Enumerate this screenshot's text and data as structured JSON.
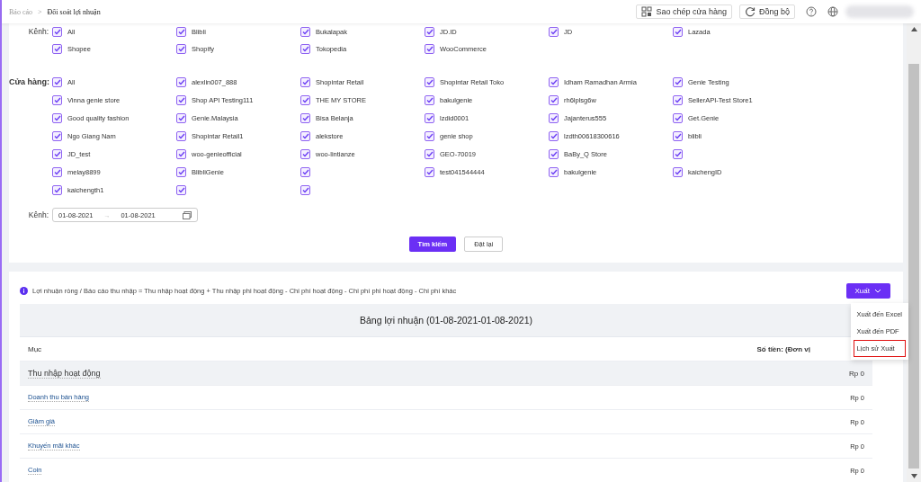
{
  "breadcrumb": {
    "parent": "Báo cáo",
    "separator": ">",
    "current": "Đối soát lợi nhuận"
  },
  "header_actions": {
    "copy_store": "Sao chép cửa hàng",
    "sync": "Đồng bộ"
  },
  "channels": {
    "label": "Kênh:",
    "options": [
      {
        "label": "All",
        "checked": true
      },
      {
        "label": "Blibli",
        "checked": true
      },
      {
        "label": "Bukalapak",
        "checked": true
      },
      {
        "label": "JD.ID",
        "checked": true
      },
      {
        "label": "JD",
        "checked": true
      },
      {
        "label": "Lazada",
        "checked": true
      },
      {
        "label": "Shopee",
        "checked": true
      },
      {
        "label": "Shopify",
        "checked": true
      },
      {
        "label": "Tokopedia",
        "checked": true
      },
      {
        "label": "WooCommerce",
        "checked": true
      }
    ]
  },
  "stores": {
    "label": "Cửa hàng:",
    "options": [
      {
        "label": "All",
        "checked": true
      },
      {
        "label": "alexlin007_888",
        "checked": true
      },
      {
        "label": "Shopintar Retail",
        "checked": true
      },
      {
        "label": "Shopintar Retail Toko",
        "checked": true
      },
      {
        "label": "Idham Ramadhan Armia",
        "checked": true
      },
      {
        "label": "Genie Testing",
        "checked": true
      },
      {
        "label": "Vinna genie store",
        "checked": true
      },
      {
        "label": "Shop API Testing111",
        "checked": true
      },
      {
        "label": "THE MY STORE",
        "checked": true
      },
      {
        "label": "bakulgenie",
        "checked": true
      },
      {
        "label": "rh6lplsg6w",
        "checked": true
      },
      {
        "label": "SellerAPI-Test Store1",
        "checked": true
      },
      {
        "label": "Good quality fashion",
        "checked": true
      },
      {
        "label": "Genie.Malaysia",
        "checked": true
      },
      {
        "label": "Bisa Belanja",
        "checked": true
      },
      {
        "label": "lzdid0001",
        "checked": true
      },
      {
        "label": "Jajanterus555",
        "checked": true
      },
      {
        "label": "Get.Genie",
        "checked": true
      },
      {
        "label": "Ngo Giang Nam",
        "checked": true
      },
      {
        "label": "Shopintar Retail1",
        "checked": true
      },
      {
        "label": "alekstore",
        "checked": true
      },
      {
        "label": "genie shop",
        "checked": true
      },
      {
        "label": "lzdth00618300616",
        "checked": true
      },
      {
        "label": "blibli",
        "checked": true
      },
      {
        "label": "JD_test",
        "checked": true
      },
      {
        "label": "woo-genieofficial",
        "checked": true
      },
      {
        "label": "woo-lintianze",
        "checked": true
      },
      {
        "label": "GEO-70019",
        "checked": true
      },
      {
        "label": "BaBy_Q Store",
        "checked": true
      },
      {
        "checked": true
      },
      {
        "label": "melay8899",
        "checked": true
      },
      {
        "label": "BlibliGenie",
        "checked": true
      },
      {
        "checked": true
      },
      {
        "label": "test041544444",
        "checked": true
      },
      {
        "label": "bakulgenie",
        "checked": true
      },
      {
        "label": "kaichengID",
        "checked": true
      },
      {
        "label": "kaichength1",
        "checked": true
      },
      {
        "checked": true
      },
      {
        "checked": true
      }
    ]
  },
  "date_range": {
    "label": "Kênh:",
    "start": "01-08-2021",
    "separator": "→",
    "end": "01-08-2021"
  },
  "buttons": {
    "search": "Tìm kiếm",
    "reset": "Đặt lại"
  },
  "formula": "Lợi nhuận ròng / Báo cáo thu nhập = Thu nhập hoạt động + Thu nhập phi hoạt động - Chi phí hoạt động - Chi phí phi hoạt động - Chi phí khác",
  "export": {
    "label": "Xuất",
    "expanded": true,
    "items": [
      {
        "label": "Xuất đến Excel",
        "highlighted": false
      },
      {
        "label": "Xuất đến PDF",
        "highlighted": false
      },
      {
        "label": "Lịch sử Xuất",
        "highlighted": true
      }
    ]
  },
  "table": {
    "title": "Bảng lợi nhuận (01-08-2021-01-08-2021)",
    "column_1": "Mục",
    "column_2": "Số tiền: (Đơn vị",
    "rows": [
      {
        "kind": "group",
        "label": "Thu nhập hoạt động",
        "amount": "Rp 0"
      },
      {
        "kind": "item",
        "label": "Doanh thu bán hàng",
        "amount": "Rp 0"
      },
      {
        "kind": "item",
        "label": "Giảm giá",
        "amount": "Rp 0"
      },
      {
        "kind": "item",
        "label": "Khuyến mãi khác",
        "amount": "Rp 0"
      },
      {
        "kind": "item",
        "label": "Coin",
        "amount": "Rp 0"
      }
    ]
  }
}
